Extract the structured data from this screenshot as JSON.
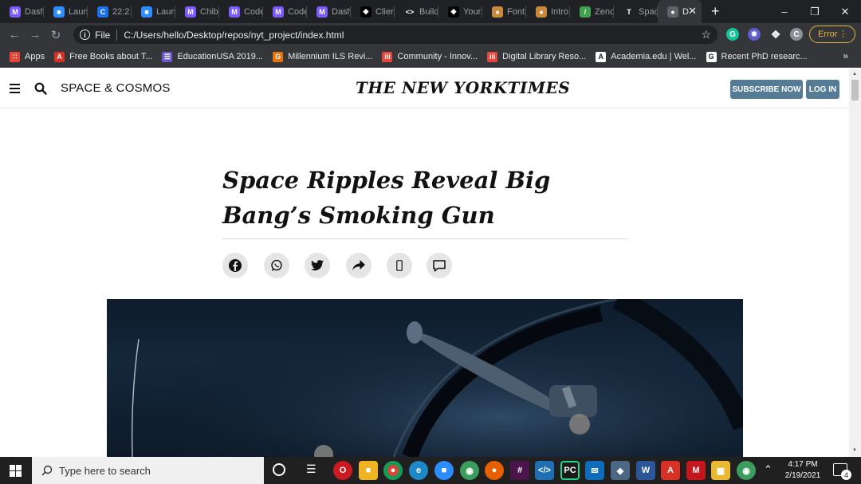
{
  "browser": {
    "tabs": [
      {
        "label": "Dash",
        "color": "#7c5cff",
        "glyph": "M"
      },
      {
        "label": "Laun",
        "color": "#2d8cff",
        "glyph": "■"
      },
      {
        "label": "22:2",
        "color": "#1a73e8",
        "glyph": "C"
      },
      {
        "label": "Laun",
        "color": "#2d8cff",
        "glyph": "■"
      },
      {
        "label": "Chib",
        "color": "#7c5cff",
        "glyph": "M"
      },
      {
        "label": "Code",
        "color": "#7c5cff",
        "glyph": "M"
      },
      {
        "label": "Code",
        "color": "#7c5cff",
        "glyph": "M"
      },
      {
        "label": "Dash",
        "color": "#7c5cff",
        "glyph": "M"
      },
      {
        "label": "Clier",
        "color": "#000000",
        "glyph": "◆"
      },
      {
        "label": "Build",
        "color": "#202124",
        "glyph": "<>"
      },
      {
        "label": "Your",
        "color": "#000000",
        "glyph": "◆"
      },
      {
        "label": "Font",
        "color": "#c88a3a",
        "glyph": "♠"
      },
      {
        "label": "Intro",
        "color": "#c88a3a",
        "glyph": "♠"
      },
      {
        "label": "Zenc",
        "color": "#3fa34d",
        "glyph": "/"
      },
      {
        "label": "Spac",
        "color": "#202124",
        "glyph": "T"
      },
      {
        "label": "D",
        "color": "#5f6368",
        "glyph": "●",
        "active": true
      }
    ],
    "address": {
      "scheme_label": "File",
      "url": "C:/Users/hello/Desktop/repos/nyt_project/index.html"
    },
    "profile_initial": "C",
    "error_label": "Error",
    "bookmarks": [
      {
        "label": "Apps",
        "color": "#ea4335",
        "glyph": "∷"
      },
      {
        "label": "Free Books about T...",
        "color": "#d93025",
        "glyph": "A"
      },
      {
        "label": "EducationUSA 2019...",
        "color": "#6a5acd",
        "glyph": "☰"
      },
      {
        "label": "Millennium ILS Revi...",
        "color": "#e8710a",
        "glyph": "G"
      },
      {
        "label": "Community - Innov...",
        "color": "#e8453c",
        "glyph": "iii"
      },
      {
        "label": "Digital Library Reso...",
        "color": "#e8453c",
        "glyph": "iii"
      },
      {
        "label": "Academia.edu | Wel...",
        "color": "#ffffff",
        "glyph": "A"
      },
      {
        "label": "Recent PhD researc...",
        "color": "#ffffff",
        "glyph": "G"
      }
    ],
    "bookmarks_more": "»"
  },
  "page": {
    "section": "SPACE & COSMOS",
    "logo": "THE NEW YORKTIMES",
    "subscribe_label": "SUBSCRIBE NOW",
    "login_label": "LOG IN",
    "headline": "Space Ripples Reveal Big Bang’s Smoking Gun",
    "share_icons": [
      "facebook-icon",
      "whatsapp-icon",
      "twitter-icon",
      "share-arrow-icon",
      "mobile-icon",
      "comment-icon"
    ]
  },
  "taskbar": {
    "search_placeholder": "Type here to search",
    "time": "4:17 PM",
    "date": "2/19/2021",
    "notification_count": "4"
  }
}
